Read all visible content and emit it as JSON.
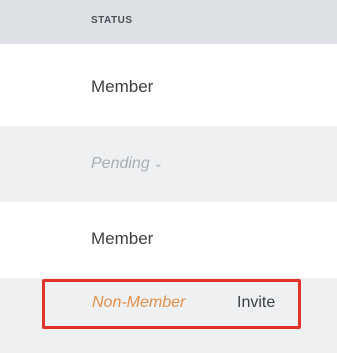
{
  "table": {
    "header": {
      "status_label": "STATUS"
    },
    "rows": [
      {
        "status": "Member"
      },
      {
        "status": "Pending",
        "chevron": "⌄"
      },
      {
        "status": "Member"
      },
      {
        "status": "Non-Member",
        "action": "Invite"
      }
    ]
  },
  "colors": {
    "header_bg": "#dde1e5",
    "alt_row_bg": "#eef0f2",
    "nonmember_text": "#e3904a",
    "highlight_border": "#e0342a",
    "pending_text": "#a9aeb3"
  }
}
